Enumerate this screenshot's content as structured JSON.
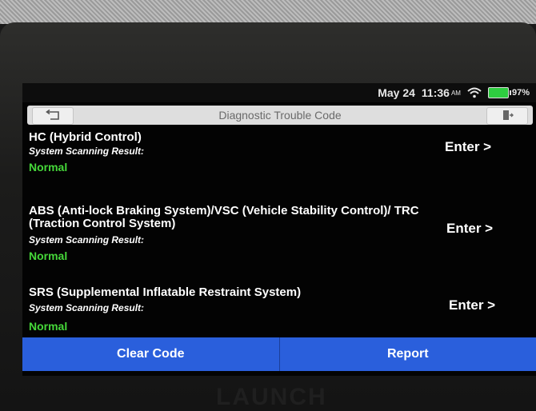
{
  "status_bar": {
    "date": "May 24",
    "time": "11:36",
    "ampm": "AM",
    "battery": "97%",
    "battery_level": 0.97,
    "battery_color": "#2ecc40"
  },
  "title_bar": {
    "title": "Diagnostic Trouble Code",
    "back_icon": "back-arrow-icon",
    "exit_icon": "exit-door-icon"
  },
  "systems": [
    {
      "name": "HC (Hybrid Control)",
      "result_label": "System Scanning Result:",
      "status": "Normal",
      "action": "Enter >"
    },
    {
      "name": "ABS (Anti-lock Braking System)/VSC (Vehicle Stability Control)/ TRC (Traction Control System)",
      "result_label": "System Scanning Result:",
      "status": "Normal",
      "action": "Enter >"
    },
    {
      "name": "SRS (Supplemental Inflatable Restraint System)",
      "result_label": "System Scanning Result:",
      "status": "Normal",
      "action": "Enter >"
    }
  ],
  "bottom_bar": {
    "clear_code": "Clear Code",
    "report": "Report"
  },
  "device_brand": "LAUNCH",
  "colors": {
    "accent_blue": "#2a5fdc",
    "status_green": "#46d83a"
  }
}
